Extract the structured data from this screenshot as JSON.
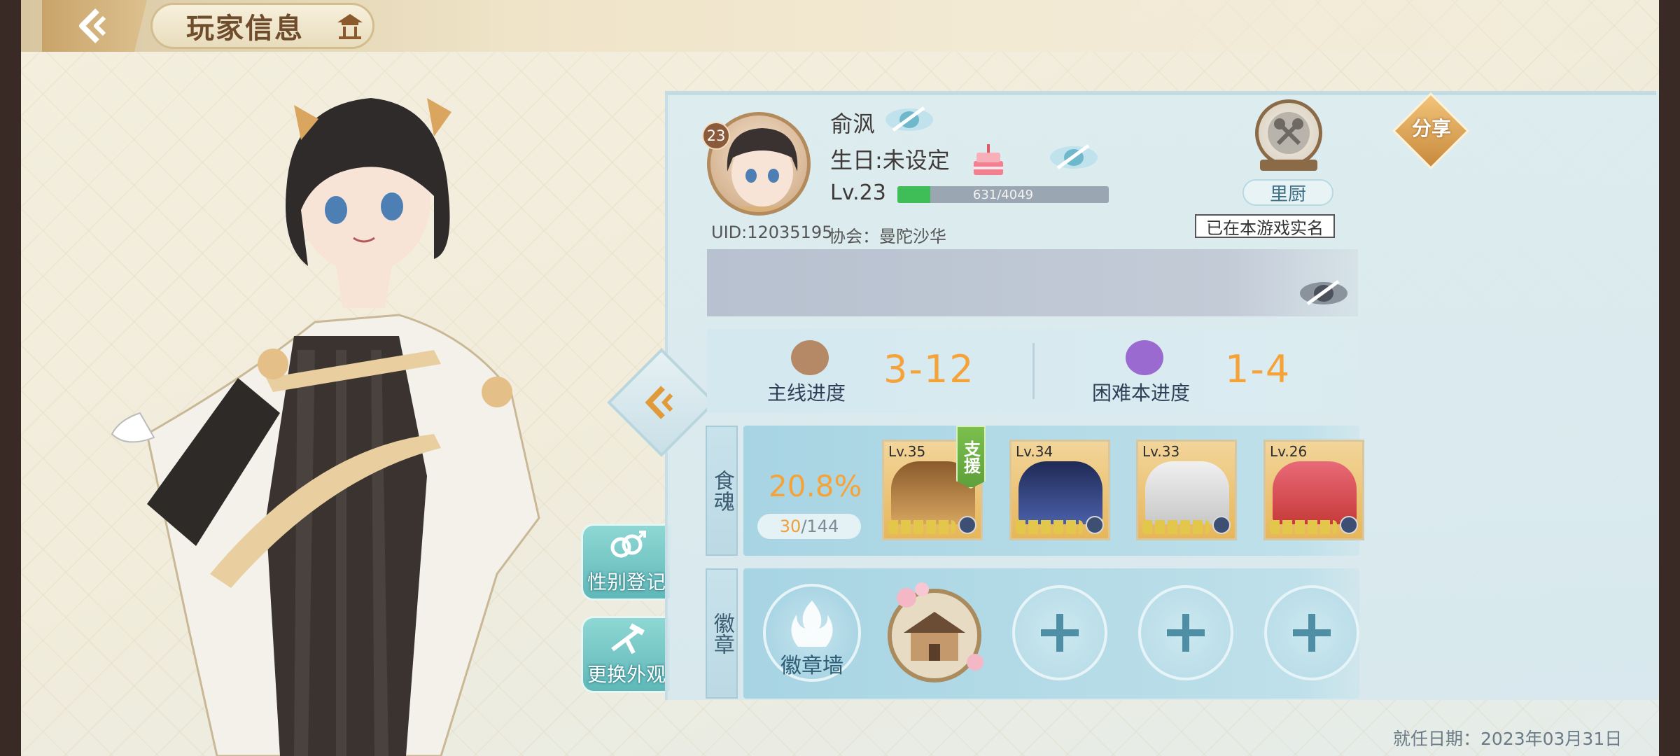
{
  "header": {
    "title": "玩家信息",
    "back_icon": "back-arrow-icon",
    "home_icon": "pavilion-icon"
  },
  "profile": {
    "name": "俞沨",
    "birthday": "生日:未设定",
    "level_badge": "23",
    "level_label": "Lv.23",
    "xp_text": "631/4049",
    "xp_fraction": 0.156,
    "uid": "UID:12035195",
    "guild": "协会：曼陀沙华",
    "chef_title": "里厨",
    "real_name_status": "已在本游戏实名",
    "share_label": "分享"
  },
  "progress": {
    "main_label": "主线进度",
    "main_value": "3-12",
    "hard_label": "困难本进度",
    "hard_value": "1-4"
  },
  "souls": {
    "section_label": "食魂",
    "percent": "20.8%",
    "count_owned": "30",
    "count_total": "/144",
    "support_label": "支援",
    "cards": [
      {
        "level": "Lv.35"
      },
      {
        "level": "Lv.34"
      },
      {
        "level": "Lv.33"
      },
      {
        "level": "Lv.26"
      }
    ]
  },
  "badges": {
    "section_label": "徽章",
    "wall_label": "徽章墙"
  },
  "side_buttons": {
    "gender": "性别登记",
    "appearance": "更换外观"
  },
  "footer": {
    "date": "就任日期：2023年03月31日"
  },
  "colors": {
    "accent_orange": "#f5a339",
    "xp_green": "#3fbe57",
    "panel_blue": "#dcecf0"
  }
}
